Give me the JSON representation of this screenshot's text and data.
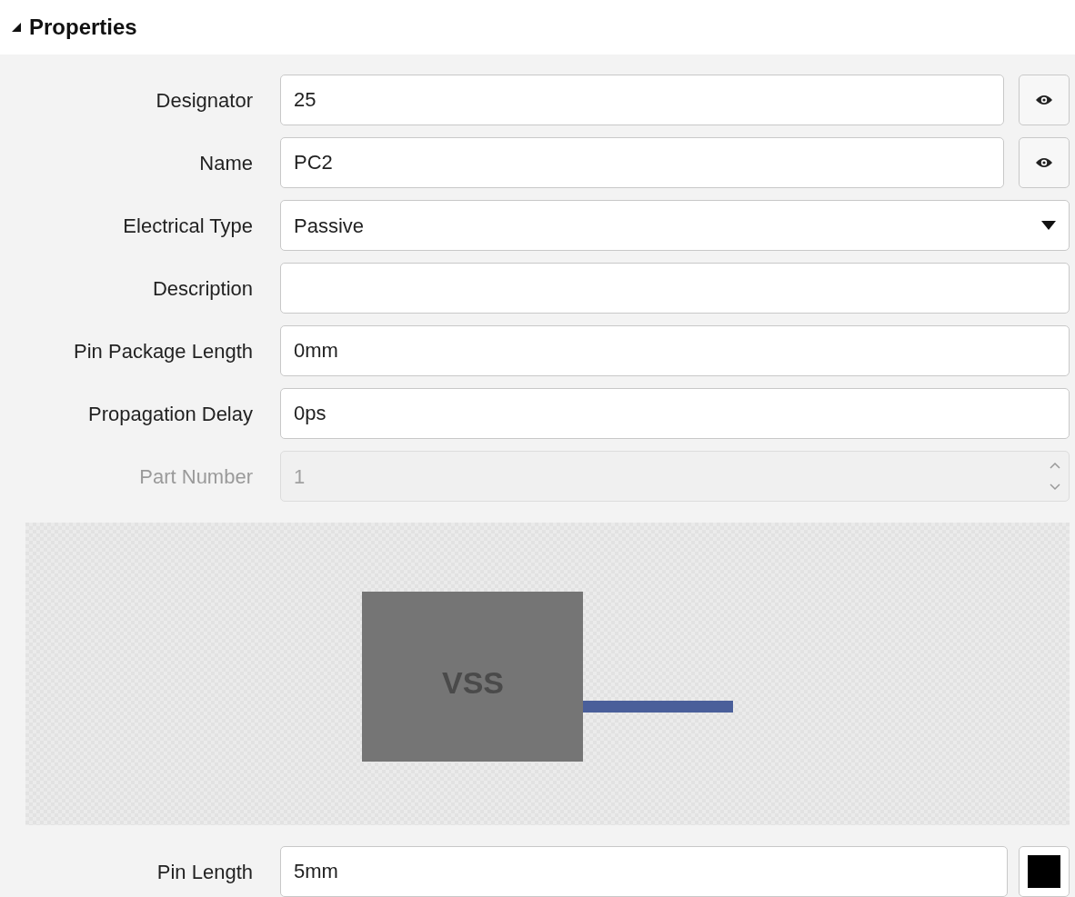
{
  "section": {
    "title": "Properties",
    "expanded": true
  },
  "rows": [
    {
      "kind": "text-eye",
      "label": "Designator",
      "value": "25",
      "disabled": false
    },
    {
      "kind": "text-eye",
      "label": "Name",
      "value": "PC2",
      "disabled": false
    },
    {
      "kind": "select",
      "label": "Electrical Type",
      "value": "Passive",
      "disabled": false
    },
    {
      "kind": "text",
      "label": "Description",
      "disabled": false
    },
    {
      "kind": "text",
      "label": "Pin Package Length",
      "value": "0mm",
      "disabled": false
    },
    {
      "kind": "text",
      "label": "Propagation Delay",
      "value": "0ps",
      "disabled": false
    },
    {
      "kind": "spinner",
      "label": "Part Number",
      "value": "1",
      "disabled": true
    }
  ],
  "preview": {
    "pin_name": "VSS"
  },
  "pin_length": {
    "label": "Pin Length",
    "value": "5mm",
    "color": "#000000"
  }
}
